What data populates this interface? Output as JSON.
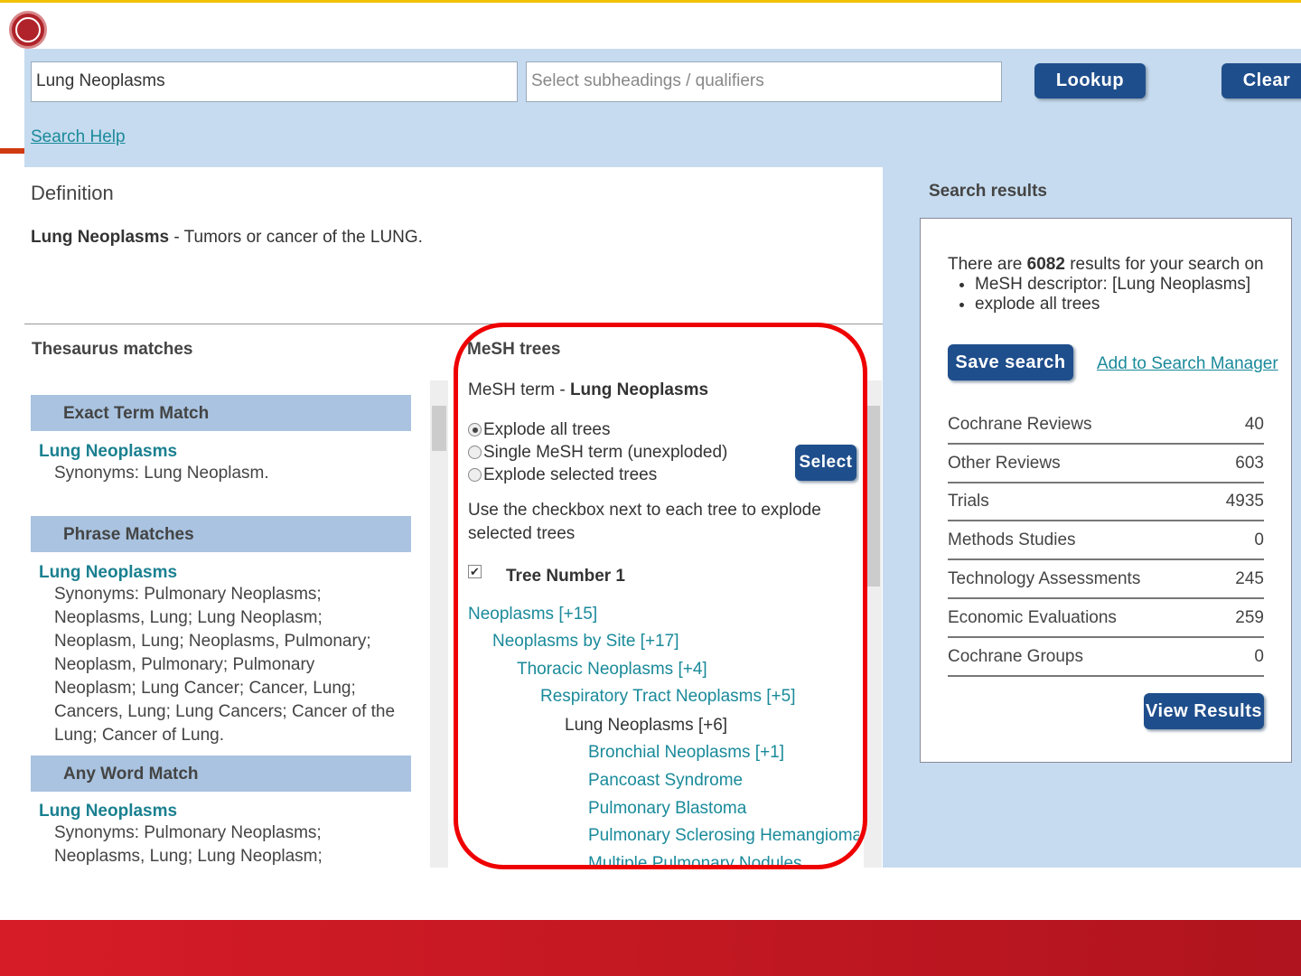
{
  "search": {
    "term": "Lung Neoplasms",
    "qualifier_placeholder": "Select subheadings / qualifiers",
    "lookup": "Lookup",
    "clear": "Clear",
    "help": "Search Help"
  },
  "definition": {
    "heading": "Definition",
    "term": "Lung Neoplasms",
    "text": " - Tumors or cancer of the LUNG."
  },
  "thesaurus": {
    "heading": "Thesaurus matches",
    "sections": [
      {
        "title": "Exact Term Match",
        "term": "Lung Neoplasms",
        "synonyms": "Synonyms: Lung Neoplasm."
      },
      {
        "title": "Phrase Matches",
        "term": "Lung Neoplasms",
        "synonyms": "Synonyms: Pulmonary Neoplasms; Neoplasms, Lung; Lung Neoplasm; Neoplasm, Lung; Neoplasms, Pulmonary; Neoplasm, Pulmonary; Pulmonary Neoplasm; Lung Cancer; Cancer, Lung; Cancers, Lung; Lung Cancers; Cancer of the Lung; Cancer of Lung."
      },
      {
        "title": "Any Word Match",
        "term": "Lung Neoplasms",
        "synonyms": "Synonyms: Pulmonary Neoplasms; Neoplasms, Lung; Lung Neoplasm; Neoplasm, Lung;"
      }
    ]
  },
  "mesh": {
    "heading": "MeSH trees",
    "term_label": "MeSH term - ",
    "term": "Lung Neoplasms",
    "options": [
      "Explode all trees",
      "Single MeSH term (unexploded)",
      "Explode selected trees"
    ],
    "select": "Select",
    "instructions": "Use the checkbox next to each tree to explode selected trees",
    "tree_label": "Tree Number 1",
    "tree": [
      "Neoplasms [+15]",
      "Neoplasms by Site [+17]",
      "Thoracic Neoplasms [+4]",
      "Respiratory Tract Neoplasms [+5]",
      "Lung Neoplasms [+6]",
      "Bronchial Neoplasms [+1]",
      "Pancoast Syndrome",
      "Pulmonary Blastoma",
      "Pulmonary Sclerosing Hemangioma",
      "Multiple Pulmonary Nodules"
    ]
  },
  "results": {
    "heading": "Search results",
    "pre": "There are ",
    "count": "6082",
    "post": " results for your search on",
    "bullets": [
      "MeSH descriptor: [Lung Neoplasms]",
      "explode all trees"
    ],
    "save": "Save search",
    "add": "Add to Search Manager",
    "rows": [
      {
        "label": "Cochrane Reviews",
        "value": "40"
      },
      {
        "label": "Other Reviews",
        "value": "603"
      },
      {
        "label": "Trials",
        "value": "4935"
      },
      {
        "label": "Methods Studies",
        "value": "0"
      },
      {
        "label": "Technology Assessments",
        "value": "245"
      },
      {
        "label": "Economic Evaluations",
        "value": "259"
      },
      {
        "label": "Cochrane Groups",
        "value": "0"
      }
    ],
    "view": "View Results"
  }
}
